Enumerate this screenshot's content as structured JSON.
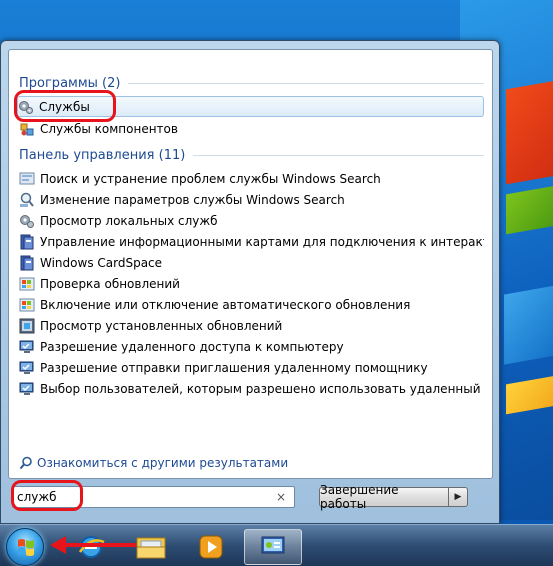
{
  "programs_group": {
    "label": "Программы (2)"
  },
  "programs": [
    {
      "label": "Службы",
      "icon": "gears-icon"
    },
    {
      "label": "Службы компонентов",
      "icon": "component-services-icon"
    }
  ],
  "control_panel_group": {
    "label": "Панель управления (11)"
  },
  "control_panel": [
    {
      "label": "Поиск и устранение проблем службы Windows Search",
      "icon": "troubleshoot-icon"
    },
    {
      "label": "Изменение параметров службы Windows Search",
      "icon": "indexing-icon"
    },
    {
      "label": "Просмотр локальных служб",
      "icon": "gears-icon"
    },
    {
      "label": "Управление информационными картами для подключения к интерактивны...",
      "icon": "cardspace-icon"
    },
    {
      "label": "Windows CardSpace",
      "icon": "cardspace-icon"
    },
    {
      "label": "Проверка обновлений",
      "icon": "windows-update-icon"
    },
    {
      "label": "Включение или отключение автоматического обновления",
      "icon": "windows-update-icon"
    },
    {
      "label": "Просмотр установленных обновлений",
      "icon": "installed-updates-icon"
    },
    {
      "label": "Разрешение удаленного доступа к компьютеру",
      "icon": "remote-access-icon"
    },
    {
      "label": "Разрешение отправки приглашения удаленному помощнику",
      "icon": "remote-assistance-icon"
    },
    {
      "label": "Выбор пользователей, которым разрешено использовать удаленный рабоч...",
      "icon": "remote-users-icon"
    }
  ],
  "more_results": {
    "label": "Ознакомиться с другими результатами",
    "icon": "search-icon"
  },
  "search": {
    "value": "служб",
    "clear_glyph": "×"
  },
  "shutdown": {
    "label": "Завершение работы",
    "arrow_glyph": "▶"
  },
  "taskbar": {
    "items": [
      {
        "name": "internet-explorer-icon"
      },
      {
        "name": "explorer-folder-icon"
      },
      {
        "name": "media-player-icon"
      },
      {
        "name": "control-panel-icon"
      }
    ]
  },
  "colors": {
    "highlight": "#e8141b",
    "group_header": "#1e4a93",
    "selection": "#dcebf8"
  }
}
